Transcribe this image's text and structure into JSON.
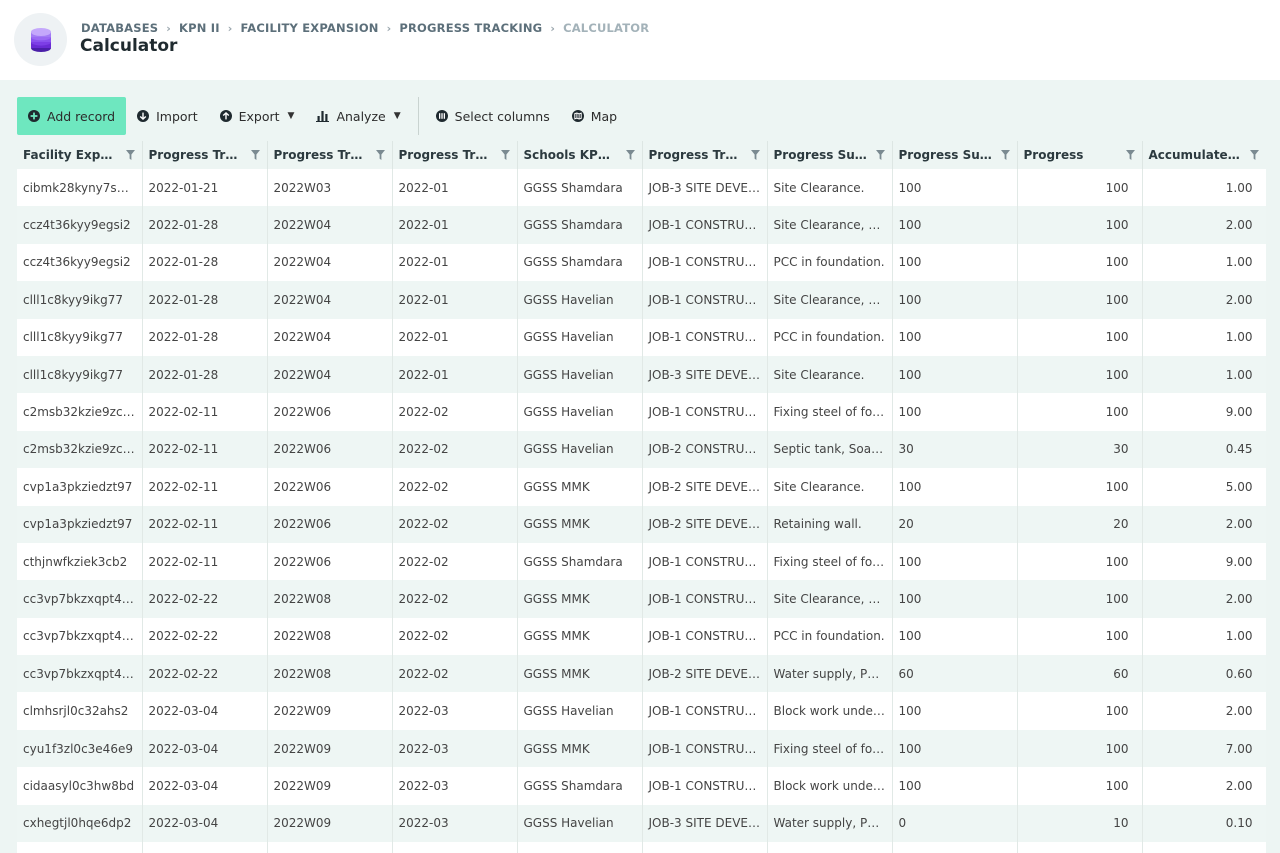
{
  "breadcrumb": {
    "items": [
      "DATABASES",
      "KPN II",
      "FACILITY EXPANSION",
      "PROGRESS TRACKING"
    ],
    "current": "CALCULATOR"
  },
  "page_title": "Calculator",
  "toolbar": {
    "add_record": "Add record",
    "import": "Import",
    "export": "Export",
    "analyze": "Analyze",
    "select_columns": "Select columns",
    "map": "Map"
  },
  "colors": {
    "primary_button": "#6ee7bf",
    "logo": "#6a2bd4"
  },
  "table": {
    "columns": [
      "Facility Expansi...",
      "Progress Tracki...",
      "Progress Tracki...",
      "Progress Tracki...",
      "Schools KPN-II ...",
      "Progress Tracki...",
      "Progress Sub-A...",
      "Progress Sub-A...",
      "Progress",
      "Accumulated Pr..."
    ],
    "rows": [
      [
        "cibmk28kyny7sv28",
        "2022-01-21",
        "2022W03",
        "2022-01",
        "GGSS Shamdara",
        "JOB-3 SITE DEVEL...",
        "Site Clearance.",
        "100",
        "100",
        "1.00"
      ],
      [
        "ccz4t36kyy9egsi2",
        "2022-01-28",
        "2022W04",
        "2022-01",
        "GGSS Shamdara",
        "JOB-1 CONSTRUC...",
        "Site Clearance, Ex...",
        "100",
        "100",
        "2.00"
      ],
      [
        "ccz4t36kyy9egsi2",
        "2022-01-28",
        "2022W04",
        "2022-01",
        "GGSS Shamdara",
        "JOB-1 CONSTRUC...",
        "PCC in foundation.",
        "100",
        "100",
        "1.00"
      ],
      [
        "clll1c8kyy9ikg77",
        "2022-01-28",
        "2022W04",
        "2022-01",
        "GGSS Havelian",
        "JOB-1 CONSTRUC...",
        "Site Clearance, Ex...",
        "100",
        "100",
        "2.00"
      ],
      [
        "clll1c8kyy9ikg77",
        "2022-01-28",
        "2022W04",
        "2022-01",
        "GGSS Havelian",
        "JOB-1 CONSTRUC...",
        "PCC in foundation.",
        "100",
        "100",
        "1.00"
      ],
      [
        "clll1c8kyy9ikg77",
        "2022-01-28",
        "2022W04",
        "2022-01",
        "GGSS Havelian",
        "JOB-3 SITE DEVEL...",
        "Site Clearance.",
        "100",
        "100",
        "1.00"
      ],
      [
        "c2msb32kzie9zce2",
        "2022-02-11",
        "2022W06",
        "2022-02",
        "GGSS Havelian",
        "JOB-1 CONSTRUC...",
        "Fixing steel of fou...",
        "100",
        "100",
        "9.00"
      ],
      [
        "c2msb32kzie9zce2",
        "2022-02-11",
        "2022W06",
        "2022-02",
        "GGSS Havelian",
        "JOB-2 CONSTRUC...",
        "Septic tank, Soak...",
        "30",
        "30",
        "0.45"
      ],
      [
        "cvp1a3pkziedzt97",
        "2022-02-11",
        "2022W06",
        "2022-02",
        "GGSS MMK",
        "JOB-2 SITE DEVEL...",
        "Site Clearance.",
        "100",
        "100",
        "5.00"
      ],
      [
        "cvp1a3pkziedzt97",
        "2022-02-11",
        "2022W06",
        "2022-02",
        "GGSS MMK",
        "JOB-2 SITE DEVEL...",
        "Retaining wall.",
        "20",
        "20",
        "2.00"
      ],
      [
        "cthjnwfkziek3cb2",
        "2022-02-11",
        "2022W06",
        "2022-02",
        "GGSS Shamdara",
        "JOB-1 CONSTRUC...",
        "Fixing steel of fou...",
        "100",
        "100",
        "9.00"
      ],
      [
        "cc3vp7bkzxqpt482",
        "2022-02-22",
        "2022W08",
        "2022-02",
        "GGSS MMK",
        "JOB-1 CONSTRUC...",
        "Site Clearance, Ex...",
        "100",
        "100",
        "2.00"
      ],
      [
        "cc3vp7bkzxqpt482",
        "2022-02-22",
        "2022W08",
        "2022-02",
        "GGSS MMK",
        "JOB-1 CONSTRUC...",
        "PCC in foundation.",
        "100",
        "100",
        "1.00"
      ],
      [
        "cc3vp7bkzxqpt482",
        "2022-02-22",
        "2022W08",
        "2022-02",
        "GGSS MMK",
        "JOB-2 SITE DEVEL...",
        "Water supply, PC...",
        "60",
        "60",
        "0.60"
      ],
      [
        "clmhsrjl0c32ahs2",
        "2022-03-04",
        "2022W09",
        "2022-03",
        "GGSS Havelian",
        "JOB-1 CONSTRUC...",
        "Block work under ...",
        "100",
        "100",
        "2.00"
      ],
      [
        "cyu1f3zl0c3e46e9",
        "2022-03-04",
        "2022W09",
        "2022-03",
        "GGSS MMK",
        "JOB-1 CONSTRUC...",
        "Fixing steel of fou...",
        "100",
        "100",
        "7.00"
      ],
      [
        "cidaasyl0c3hw8bd",
        "2022-03-04",
        "2022W09",
        "2022-03",
        "GGSS Shamdara",
        "JOB-1 CONSTRUC...",
        "Block work under ...",
        "100",
        "100",
        "2.00"
      ],
      [
        "cxhegtjl0hqe6dp2",
        "2022-03-04",
        "2022W09",
        "2022-03",
        "GGSS Havelian",
        "JOB-3 SITE DEVEL...",
        "Water supply, PC...",
        "0",
        "10",
        "0.10"
      ],
      [
        "",
        "",
        "",
        "",
        "",
        "",
        "",
        "",
        "",
        ""
      ]
    ]
  }
}
